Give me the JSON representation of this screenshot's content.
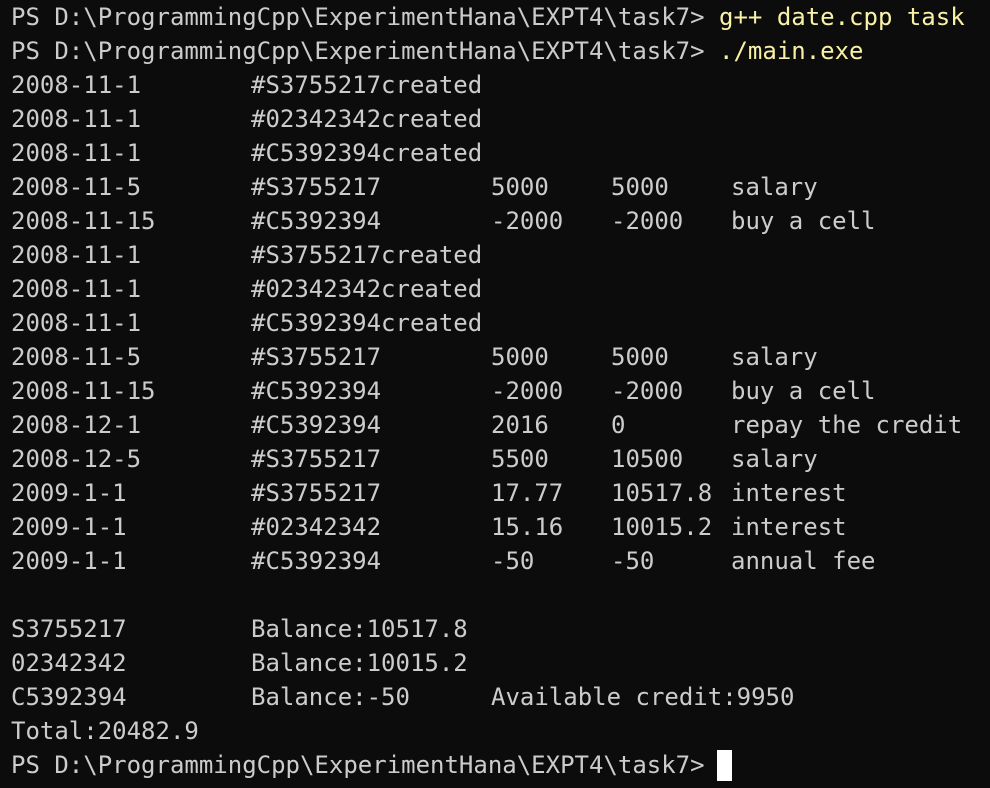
{
  "terminal": {
    "prompt_1": "PS D:\\ProgrammingCpp\\ExperimentHana\\EXPT4\\task7>",
    "command_1": "g++ date.cpp task",
    "prompt_2": "PS D:\\ProgrammingCpp\\ExperimentHana\\EXPT4\\task7>",
    "command_2": "./main.exe",
    "prompt_final": "PS D:\\ProgrammingCpp\\ExperimentHana\\EXPT4\\task7>",
    "output_rows": [
      {
        "date": "2008-11-1",
        "text": "#S3755217created"
      },
      {
        "date": "2008-11-1",
        "text": "#02342342created"
      },
      {
        "date": "2008-11-1",
        "text": "#C5392394created"
      },
      {
        "date": "2008-11-5",
        "id": "#S3755217",
        "amount": "5000",
        "balance": "5000",
        "desc": "salary"
      },
      {
        "date": "2008-11-15",
        "id": "#C5392394",
        "amount": "-2000",
        "balance": "-2000",
        "desc": "buy a cell"
      },
      {
        "date": "2008-11-1",
        "text": "#S3755217created"
      },
      {
        "date": "2008-11-1",
        "text": "#02342342created"
      },
      {
        "date": "2008-11-1",
        "text": "#C5392394created"
      },
      {
        "date": "2008-11-5",
        "id": "#S3755217",
        "amount": "5000",
        "balance": "5000",
        "desc": "salary"
      },
      {
        "date": "2008-11-15",
        "id": "#C5392394",
        "amount": "-2000",
        "balance": "-2000",
        "desc": "buy a cell"
      },
      {
        "date": "2008-12-1",
        "id": "#C5392394",
        "amount": "2016",
        "balance": "0",
        "desc": "repay the credit"
      },
      {
        "date": "2008-12-5",
        "id": "#S3755217",
        "amount": "5500",
        "balance": "10500",
        "desc": "salary"
      },
      {
        "date": "2009-1-1",
        "id": "#S3755217",
        "amount": "17.77",
        "balance": "10517.8",
        "desc": "interest"
      },
      {
        "date": "2009-1-1",
        "id": "#02342342",
        "amount": "15.16",
        "balance": "10015.2",
        "desc": "interest"
      },
      {
        "date": "2009-1-1",
        "id": "#C5392394",
        "amount": "-50",
        "balance": "-50",
        "desc": "annual fee"
      }
    ],
    "balance_rows": [
      {
        "account": "S3755217",
        "balance": "Balance:10517.8",
        "extra": ""
      },
      {
        "account": "02342342",
        "balance": "Balance:10015.2",
        "extra": ""
      },
      {
        "account": "C5392394",
        "balance": "Balance:-50",
        "extra": "Available credit:9950"
      }
    ],
    "total": "Total:20482.9"
  },
  "colors": {
    "background": "#0c0c0c",
    "text": "#cccccc",
    "command": "#f9f1a5",
    "cursor": "#ffffff"
  }
}
